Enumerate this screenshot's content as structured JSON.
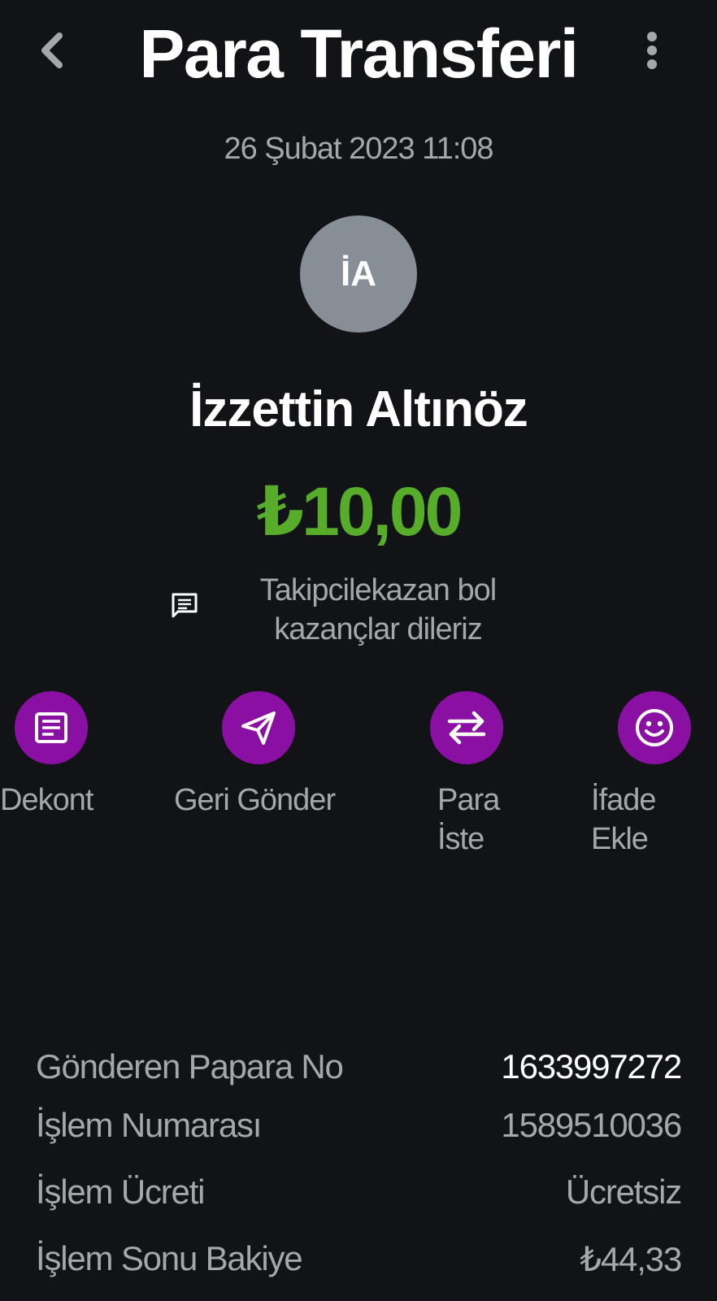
{
  "header": {
    "title": "Para Transferi",
    "back_icon": "chevron-left-icon",
    "more_icon": "more-vertical-icon"
  },
  "transaction": {
    "date": "26 Şubat 2023 11:08",
    "avatar_initials": "İA",
    "recipient_name": "İzzettin Altınöz",
    "amount": "₺10,00",
    "note_line1": "Takipcilekazan bol",
    "note_line2": "kazançlar dileriz"
  },
  "actions": [
    {
      "label": "Dekont",
      "icon": "receipt-icon"
    },
    {
      "label": "Geri Gönder",
      "icon": "send-icon"
    },
    {
      "label_line1": "Para",
      "label_line2": "İste",
      "icon": "swap-icon"
    },
    {
      "label_line1": "İfade",
      "label_line2": "Ekle",
      "icon": "smile-icon"
    }
  ],
  "details": [
    {
      "label": "Gönderen Papara No",
      "value": "1633997272"
    },
    {
      "label": "İşlem Numarası",
      "value": "1589510036"
    },
    {
      "label": "İşlem Ücreti",
      "value": "Ücretsiz"
    },
    {
      "label": "İşlem Sonu Bakiye",
      "value": "₺44,33"
    }
  ],
  "colors": {
    "background": "#121316",
    "accent_purple": "#8a0fa3",
    "amount_green": "#57ad2a",
    "avatar_gray": "#878e96",
    "muted_text": "#a6a7ab"
  }
}
